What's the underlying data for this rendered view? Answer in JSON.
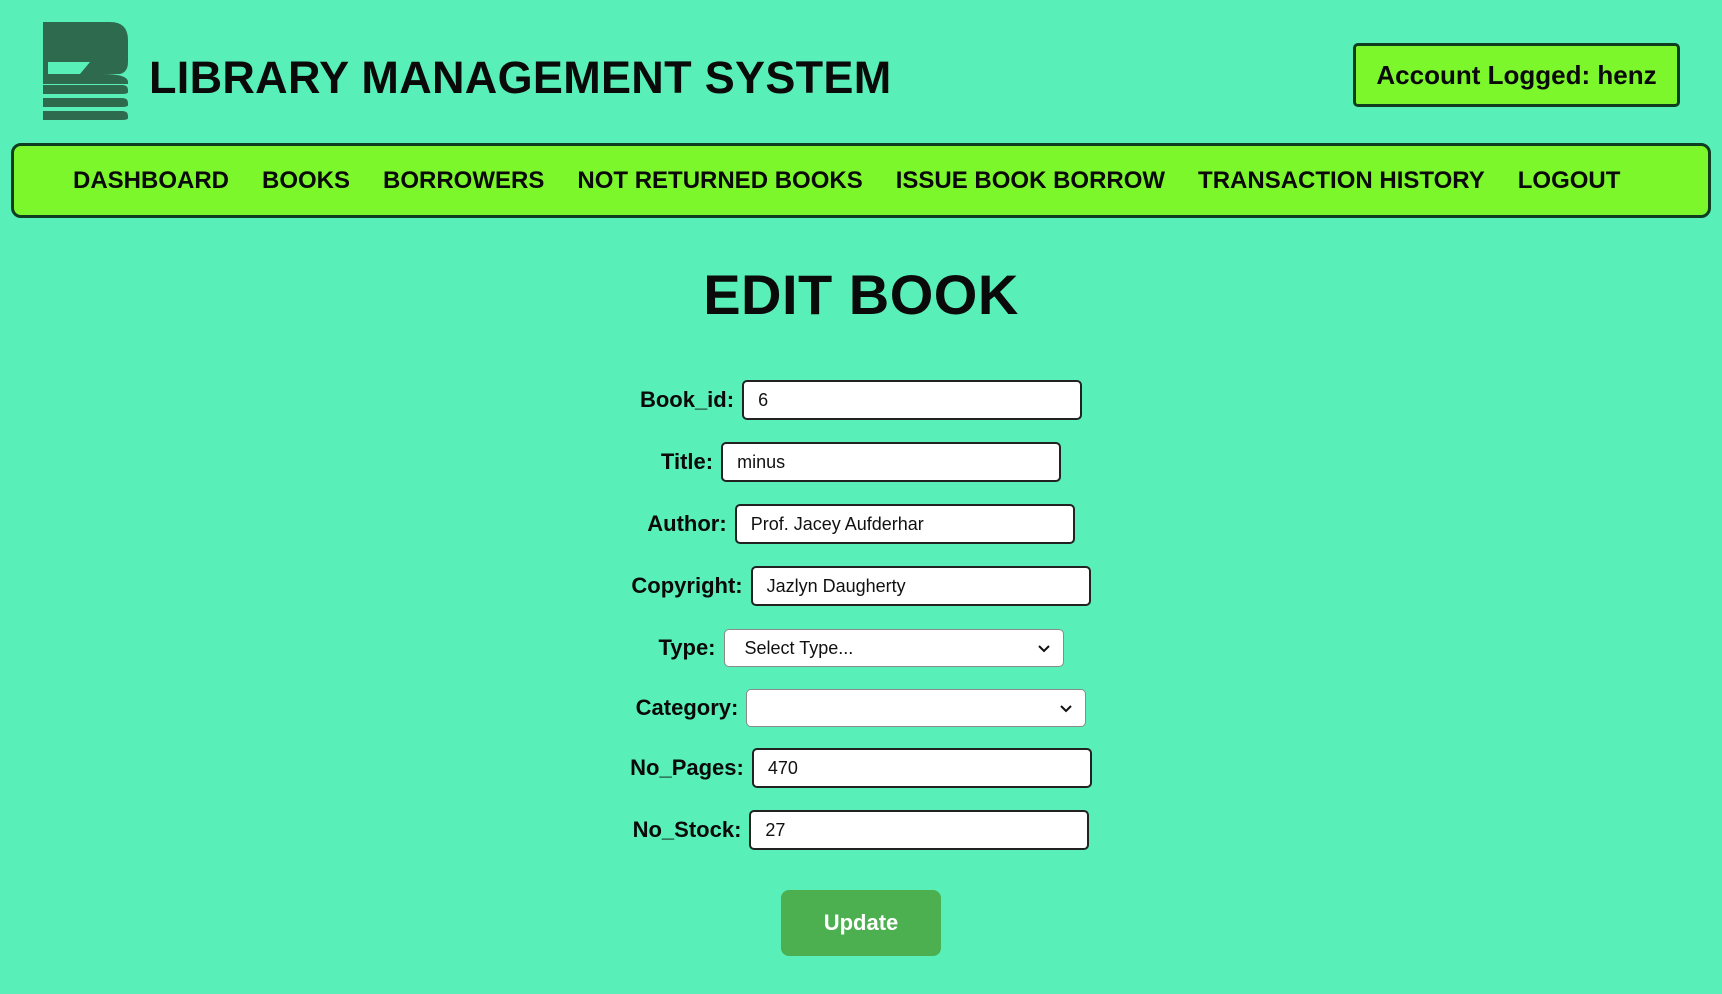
{
  "header": {
    "app_title": "LIBRARY MANAGEMENT SYSTEM",
    "account_label": "Account Logged: henz",
    "logo_icon": "library-book-logo-icon"
  },
  "nav": {
    "items": [
      {
        "label": "DASHBOARD"
      },
      {
        "label": "BOOKS"
      },
      {
        "label": "BORROWERS"
      },
      {
        "label": "NOT RETURNED BOOKS"
      },
      {
        "label": "ISSUE BOOK BORROW"
      },
      {
        "label": "TRANSACTION HISTORY"
      },
      {
        "label": "LOGOUT"
      }
    ]
  },
  "main": {
    "page_title": "EDIT BOOK",
    "form": {
      "book_id": {
        "label": "Book_id:",
        "value": "6"
      },
      "title": {
        "label": "Title:",
        "value": "minus"
      },
      "author": {
        "label": "Author:",
        "value": "Prof. Jacey Aufderhar"
      },
      "copyright": {
        "label": "Copyright:",
        "value": "Jazlyn Daugherty"
      },
      "type": {
        "label": "Type:",
        "selected": "Select Type..."
      },
      "category": {
        "label": "Category:",
        "selected": ""
      },
      "no_pages": {
        "label": "No_Pages:",
        "value": "470"
      },
      "no_stock": {
        "label": "No_Stock:",
        "value": "27"
      }
    },
    "update_label": "Update"
  },
  "colors": {
    "background": "#58f0b8",
    "nav_background": "#7cf72c",
    "border": "#0f3d1f",
    "button": "#4caf50",
    "logo": "#2e6b4e"
  }
}
